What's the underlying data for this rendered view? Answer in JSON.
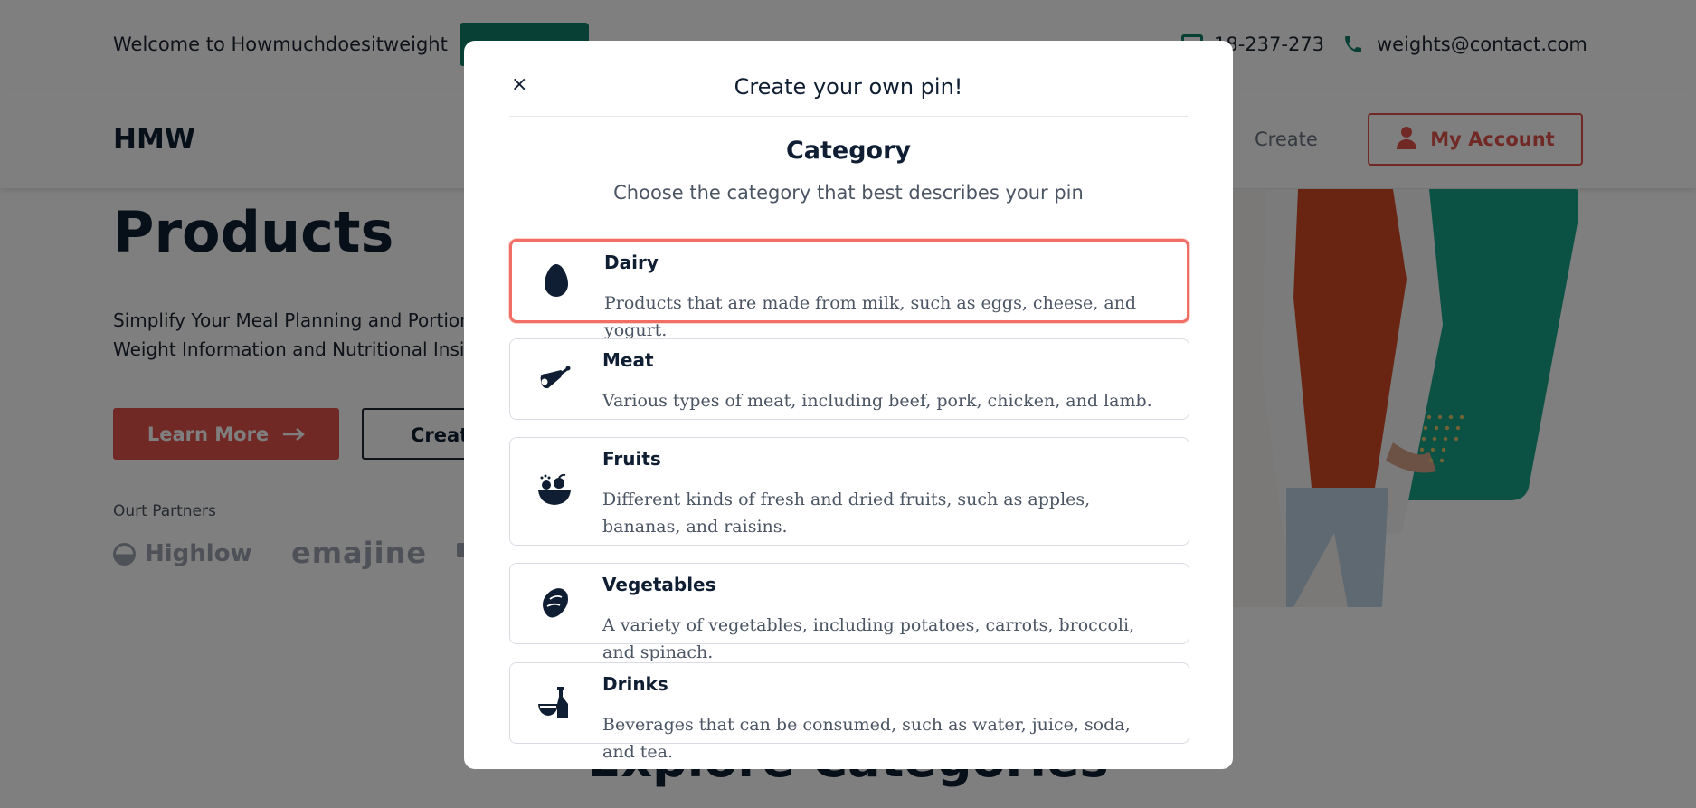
{
  "topbar": {
    "welcome": "Welcome to Howmuchdoesitweight",
    "phone": "18-237-273",
    "email": "weights@contact.com"
  },
  "navbar": {
    "logo": "HMW",
    "create_link": "Create",
    "account_label": "My Account"
  },
  "hero": {
    "title": "Products",
    "subtitle_line1": "Simplify Your Meal Planning and Portion",
    "subtitle_line2": "Weight Information and Nutritional Insig",
    "learn_more": "Learn More",
    "create_label": "Create",
    "partners_label": "Ourt Partners",
    "partners": [
      "Highlow",
      "emajine"
    ]
  },
  "explore_title": "Explore Categories",
  "modal": {
    "close": "×",
    "title": "Create your own pin!",
    "section_title": "Category",
    "section_subtitle": "Choose the category that best describes your pin",
    "categories": [
      {
        "name": "Dairy",
        "description": "Products that are made from milk, such as eggs, cheese, and yogurt.",
        "icon": "egg-icon",
        "selected": true
      },
      {
        "name": "Meat",
        "description": "Various types of meat, including beef, pork, chicken, and lamb.",
        "icon": "ham-leg-icon",
        "selected": false
      },
      {
        "name": "Fruits",
        "description": "Different kinds of fresh and dried fruits, such as apples, bananas, and raisins.",
        "icon": "fruit-bowl-icon",
        "selected": false
      },
      {
        "name": "Vegetables",
        "description": "A variety of vegetables, including potatoes, carrots, broccoli, and spinach.",
        "icon": "potato-icon",
        "selected": false
      },
      {
        "name": "Drinks",
        "description": "Beverages that can be consumed, such as water, juice, soda, and tea.",
        "icon": "drinks-icon",
        "selected": false
      }
    ]
  },
  "colors": {
    "accent": "#e0524a",
    "selected_border": "#f06e63",
    "brand_green": "#12806a",
    "dark_text": "#0f1e32"
  }
}
